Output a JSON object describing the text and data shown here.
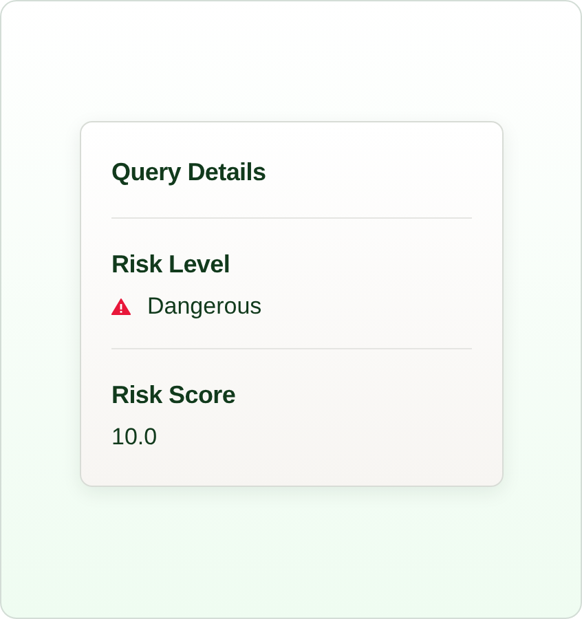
{
  "card": {
    "title": "Query Details",
    "fields": [
      {
        "label": "Risk Level",
        "value": "Dangerous",
        "kind": "warning"
      },
      {
        "label": "Risk Score",
        "value": "10.0",
        "kind": "plain"
      }
    ]
  }
}
